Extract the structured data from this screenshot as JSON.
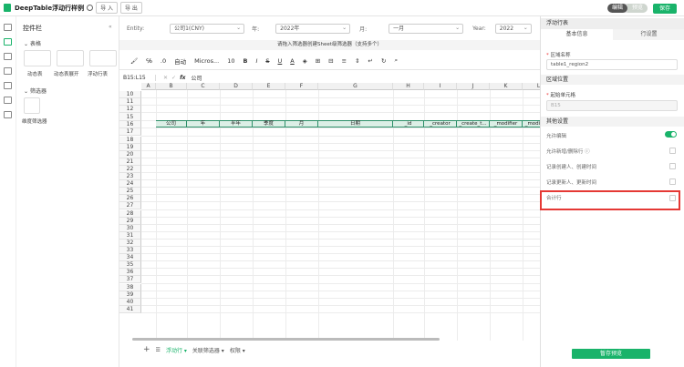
{
  "topbar": {
    "title": "DeepTable浮动行样例",
    "import": "导 入",
    "export": "导 出",
    "mode_edit": "编辑",
    "mode_preview": "预览",
    "save": "保存"
  },
  "panel": {
    "title": "控件栏",
    "collapse": "«",
    "group_table": "表格",
    "items_table": [
      "动态表",
      "动态表展开",
      "浮动行表"
    ],
    "group_filter": "筛选器",
    "items_filter": [
      "维度筛选器"
    ]
  },
  "filters": [
    {
      "label": "Entity:",
      "value": "公司1(CNY)"
    },
    {
      "label": "年:",
      "value": "2022年"
    },
    {
      "label": "月:",
      "value": "一月"
    },
    {
      "label": "Year:",
      "value": "2022"
    }
  ],
  "tip": "请拖入筛选器创建Sheet级筛选器（支持多个）",
  "toolbar": {
    "font_name": "Micros...",
    "font_size": "10",
    "auto": "自动"
  },
  "formula": {
    "cell_ref": "B15:L15",
    "value": "公司"
  },
  "sheet": {
    "columns": [
      "A",
      "B",
      "C",
      "D",
      "E",
      "F",
      "G",
      "H",
      "I",
      "J",
      "K",
      "L"
    ],
    "rows": [
      "10",
      "11",
      "12",
      "15",
      "16",
      "17",
      "18",
      "19",
      "20",
      "21",
      "22",
      "23",
      "24",
      "25",
      "26",
      "27",
      "28",
      "29",
      "30",
      "31",
      "32",
      "33",
      "34",
      "35",
      "36",
      "37",
      "38",
      "39",
      "40",
      "41"
    ],
    "header_cells": [
      "公司",
      "年",
      "半年",
      "季度",
      "月",
      "日期",
      "_id",
      "_creator",
      "_create_t...",
      "_modifier",
      "_modify_..."
    ]
  },
  "tabs": {
    "add": "+",
    "list": "☰",
    "items": [
      "浮动行",
      "关联筛选器",
      "权限"
    ]
  },
  "props": {
    "header": "浮动行表",
    "tabs": [
      "基本信息",
      "行设置"
    ],
    "name_label": "区域名称",
    "name_value": "table1_region2",
    "section_position": "区域位置",
    "start_label": "起始单元格",
    "start_value": "B15",
    "section_other": "其他设置",
    "opts": [
      "允许编辑",
      "允许新增/删除行 ⓘ",
      "记录创建人、创建时间",
      "记录更新人、更新时间",
      "合计行"
    ],
    "preview_button": "暂存预览"
  }
}
